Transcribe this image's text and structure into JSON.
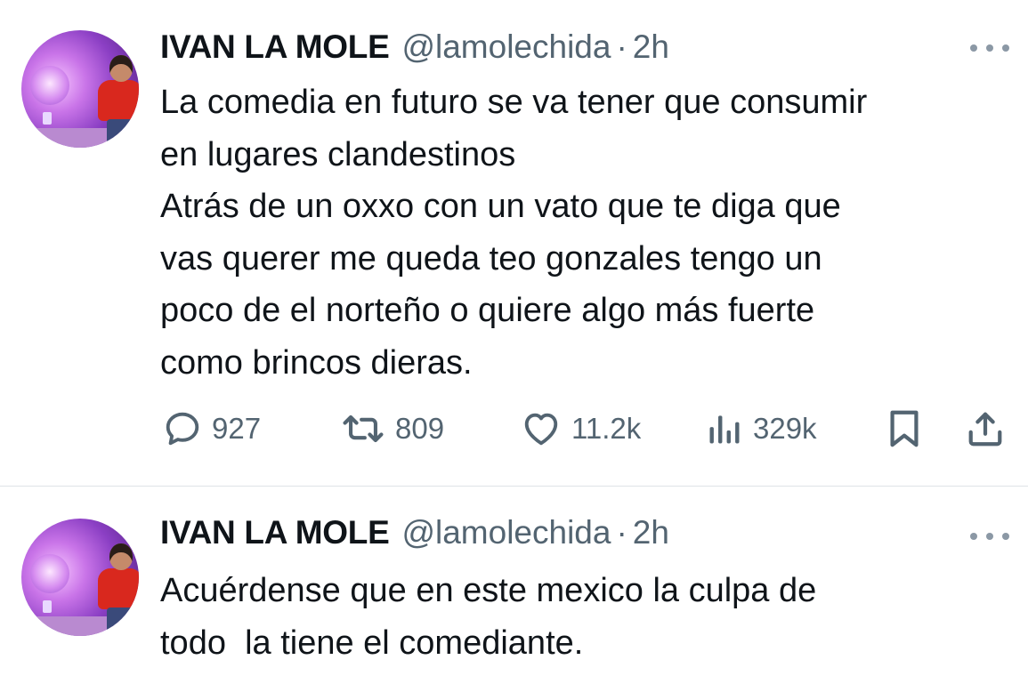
{
  "tweets": [
    {
      "author_name": "IVAN LA MOLE",
      "handle": "@lamolechida",
      "separator": "·",
      "time": "2h",
      "lines": [
        "La comedia en futuro se va tener que consumir",
        "en lugares clandestinos",
        "Atrás de un oxxo con un vato que te diga que",
        "vas querer me queda teo gonzales tengo un",
        "poco de el norteño o quiere algo más fuerte",
        "como brincos dieras."
      ],
      "stats": {
        "replies": "927",
        "reposts": "809",
        "likes": "11.2k",
        "views": "329k"
      }
    },
    {
      "author_name": "IVAN LA MOLE",
      "handle": "@lamolechida",
      "separator": "·",
      "time": "2h",
      "lines": [
        "Acuérdense que en este mexico la culpa de",
        "todo  la tiene el comediante."
      ]
    }
  ],
  "icons": {
    "reply": "reply-icon",
    "repost": "repost-icon",
    "like": "heart-icon",
    "views": "views-icon",
    "bookmark": "bookmark-icon",
    "share": "share-icon",
    "more": "more-icon"
  },
  "colors": {
    "text": "#0f1419",
    "secondary": "#536471",
    "divider": "#dfe3e7"
  }
}
